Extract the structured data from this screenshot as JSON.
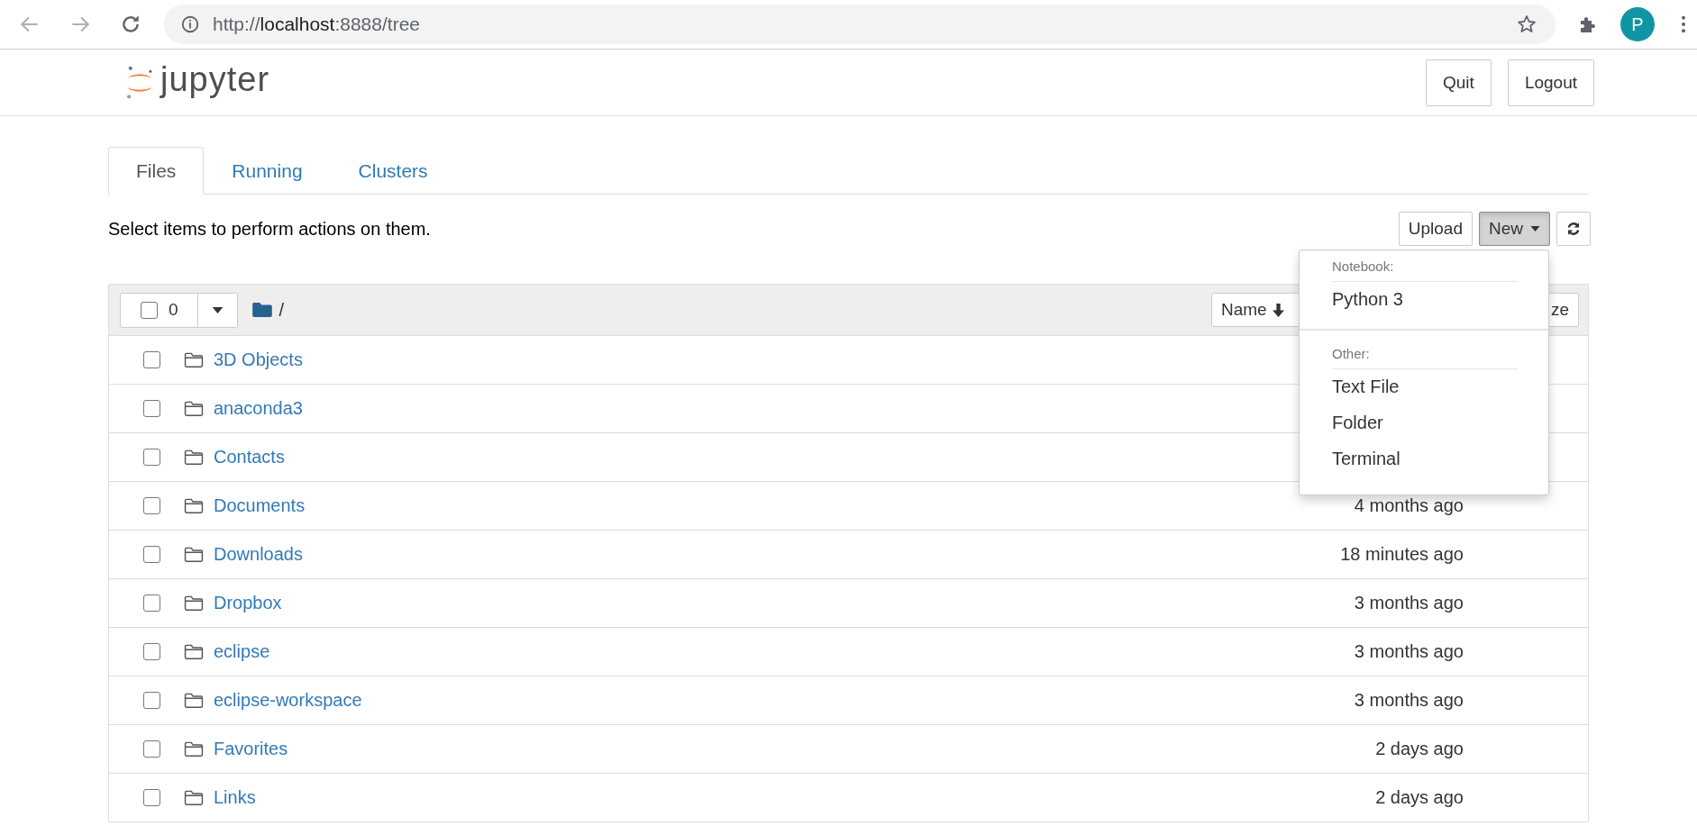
{
  "browser": {
    "url_scheme": "http://",
    "url_host": "localhost",
    "url_path": ":8888/tree",
    "profile_initial": "P"
  },
  "header": {
    "logo_text": "jupyter",
    "buttons": [
      "Quit",
      "Logout"
    ]
  },
  "tabs": [
    {
      "label": "Files",
      "selected": true
    },
    {
      "label": "Running",
      "selected": false
    },
    {
      "label": "Clusters",
      "selected": false
    }
  ],
  "toolbar": {
    "hint": "Select items to perform actions on them.",
    "buttons": [
      {
        "kind": "plain",
        "label": "Upload",
        "pressed": false
      },
      {
        "kind": "dropdown",
        "label": "New",
        "pressed": true
      },
      {
        "kind": "refresh",
        "pressed": false
      }
    ]
  },
  "list_header": {
    "checked": false,
    "selected_count": "0",
    "path": "/",
    "sort_buttons": [
      "Name",
      "ze"
    ]
  },
  "rows": [
    {
      "name": "3D Objects",
      "checked": false
    },
    {
      "name": "anaconda3",
      "checked": false
    },
    {
      "name": "Contacts",
      "checked": false
    },
    {
      "name": "Documents",
      "modified": "4 months ago",
      "checked": false
    },
    {
      "name": "Downloads",
      "modified": "18 minutes ago",
      "checked": false
    },
    {
      "name": "Dropbox",
      "modified": "3 months ago",
      "checked": false
    },
    {
      "name": "eclipse",
      "modified": "3 months ago",
      "checked": false
    },
    {
      "name": "eclipse-workspace",
      "modified": "3 months ago",
      "checked": false
    },
    {
      "name": "Favorites",
      "modified": "2 days ago",
      "checked": false
    },
    {
      "name": "Links",
      "modified": "2 days ago",
      "checked": false
    }
  ],
  "new_menu": {
    "sections": [
      {
        "header": "Notebook:",
        "items": [
          "Python 3"
        ]
      },
      {
        "header": "Other:",
        "items": [
          "Text File",
          "Folder",
          "Terminal"
        ]
      }
    ]
  }
}
